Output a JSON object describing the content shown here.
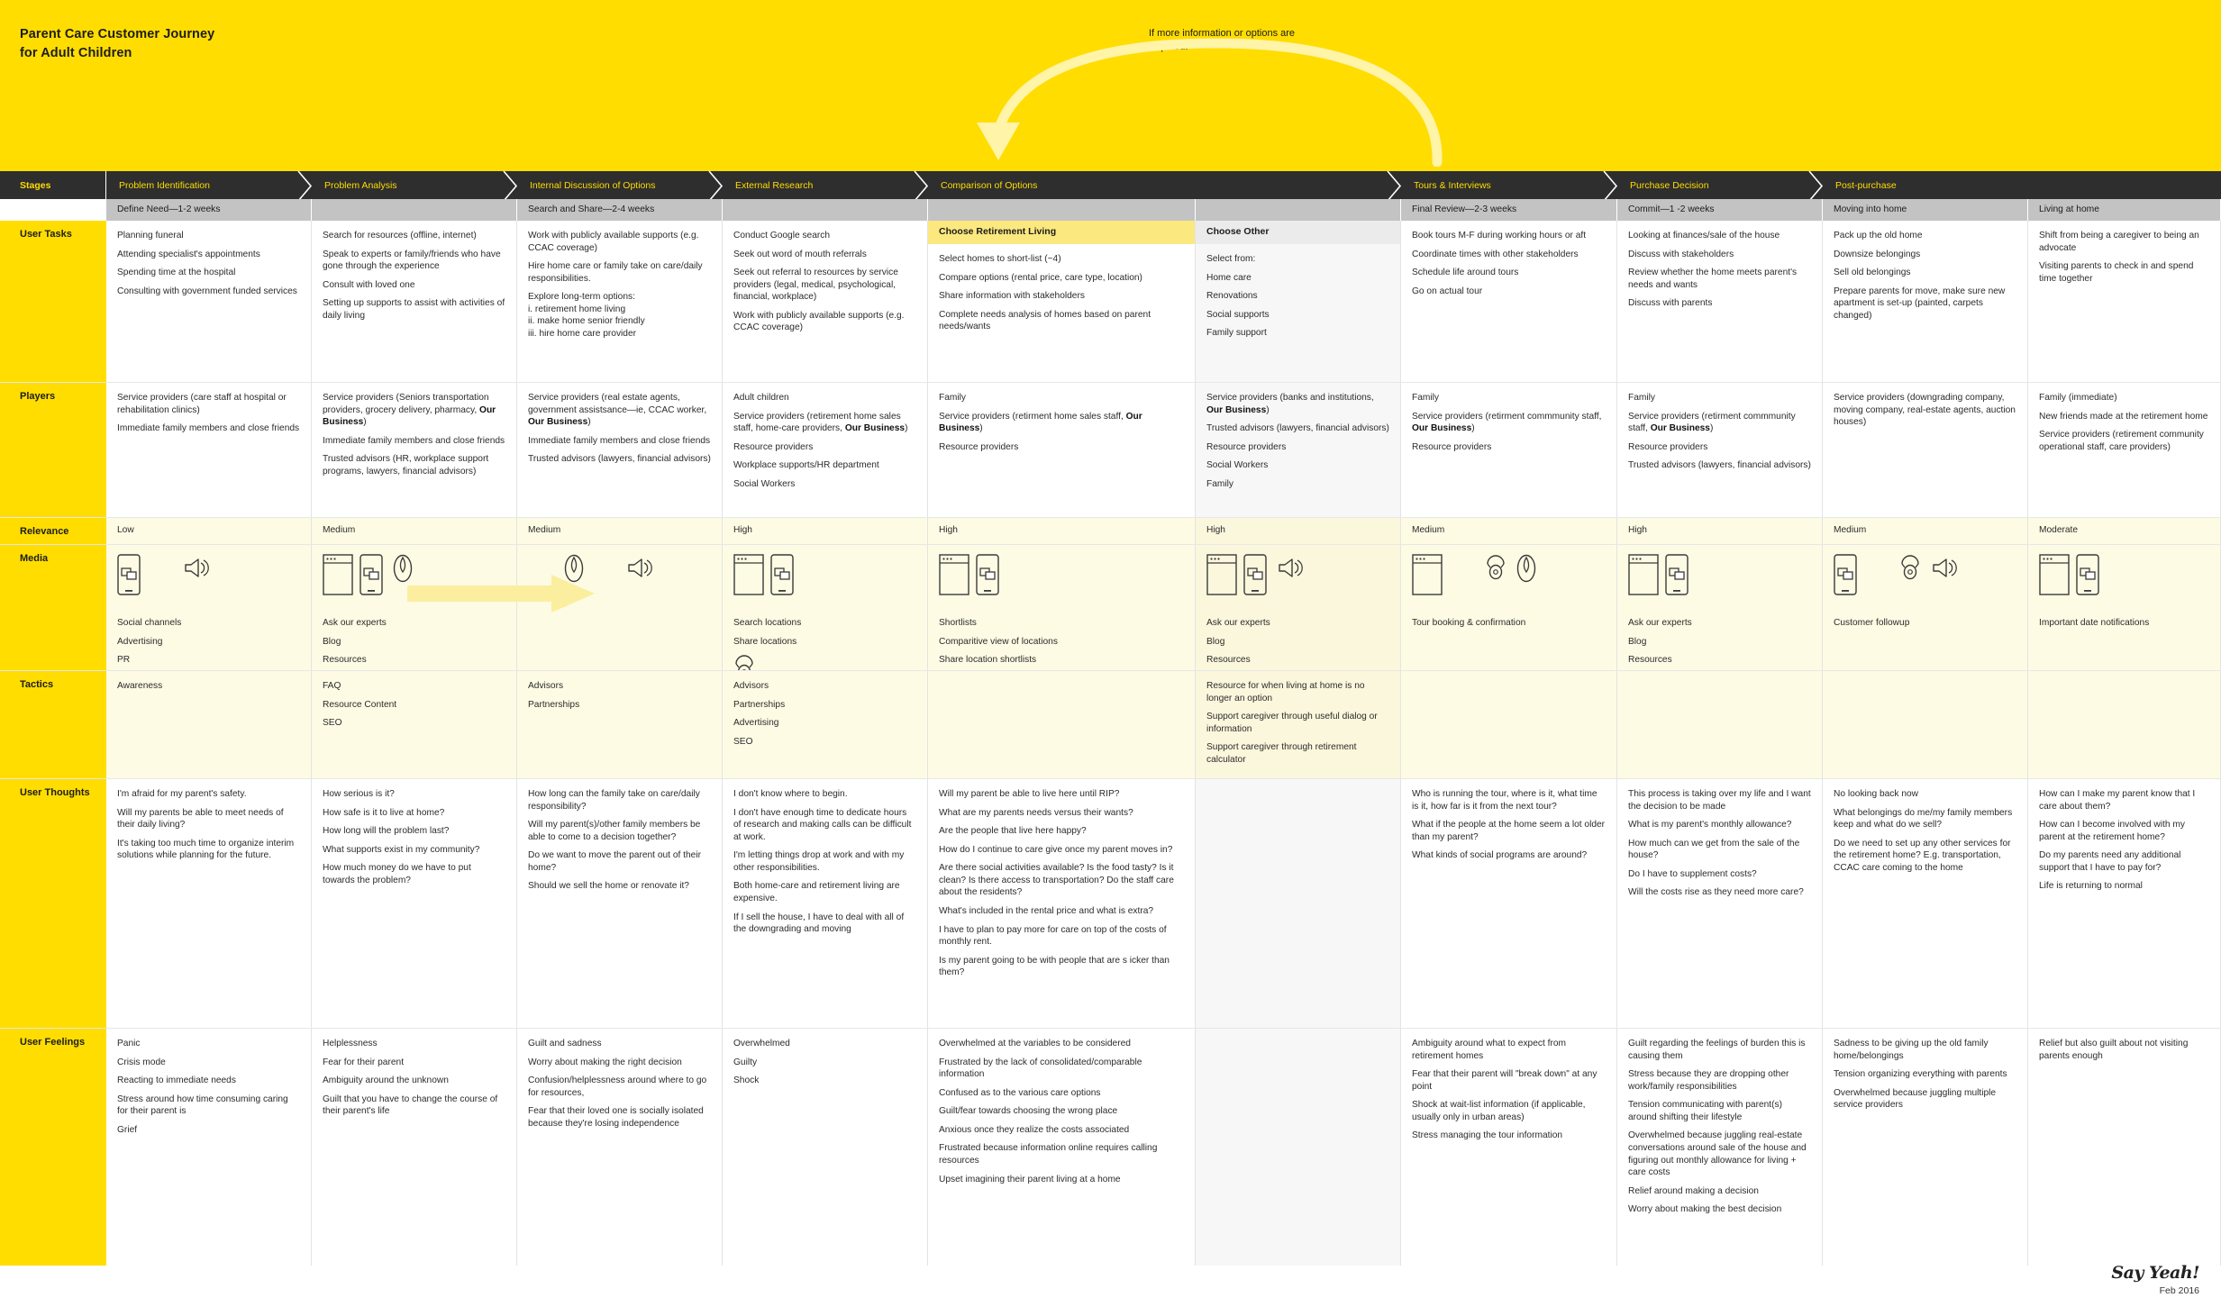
{
  "title": {
    "line1": "Parent Care Customer Journey",
    "line2": "for Adult Children"
  },
  "annotation": {
    "text": "If more information or options are required."
  },
  "colors": {
    "brand_yellow": "#FFDD00",
    "pale_yellow": "#FEFBE4",
    "dark_bar": "#2E2E2E",
    "grey_subheader": "#C3C3C3",
    "highlight_yellow": "#FBE87E"
  },
  "row_labels": {
    "stages": "Stages",
    "user_tasks": "User Tasks",
    "players": "Players",
    "relevance": "Relevance",
    "media": "Media",
    "tactics": "Tactics",
    "user_thoughts": "User Thoughts",
    "user_feelings": "User Feelings"
  },
  "stages": [
    "Problem Identification",
    "Problem Analysis",
    "Internal Discussion of Options",
    "External Research",
    "Comparison of Options",
    "Tours & Interviews",
    "Purchase Decision",
    "Post-purchase"
  ],
  "phase_headers": [
    "Define Need—1-2 weeks",
    "",
    "Search and Share—2-4 weeks",
    "",
    "",
    "",
    "Final Review—2-3 weeks",
    "Commit—1 -2 weeks",
    "Moving into home",
    "Living at home"
  ],
  "option_headers": {
    "retirement": "Choose Retirement Living",
    "other": "Choose Other"
  },
  "user_tasks": [
    [
      "Planning funeral",
      "Attending specialist's appointments",
      "Spending time at the hospital",
      "Consulting with government funded services"
    ],
    [
      "Search for resources (offline, internet)",
      "Speak to experts or family/friends who have gone through the experience",
      "Consult with loved one",
      "Setting up supports to assist with activities of daily living"
    ],
    [
      "Work with publicly available supports (e.g. CCAC coverage)",
      "Hire home care or family take on care/daily responsibilities.",
      "Explore long-term options:\ni. retirement home living\nii. make home senior friendly\niii. hire home care provider"
    ],
    [
      "Conduct Google search",
      "Seek out word of mouth referrals",
      "Seek out referral to resources by service providers (legal, medical, psychological, financial, workplace)",
      "Work with publicly available supports (e.g. CCAC coverage)"
    ],
    [
      "Select homes to short-list (~4)",
      "Compare options (rental price, care type, location)",
      "Share information with stakeholders",
      "Complete needs analysis of homes based on parent needs/wants"
    ],
    [
      "Select from:",
      "Home care",
      "Renovations",
      "Social supports",
      "Family support"
    ],
    [
      "Book tours M-F during working hours or aft",
      "Coordinate times with other stakeholders",
      "Schedule life around tours",
      "Go on actual tour"
    ],
    [
      "Looking at finances/sale of the house",
      "Discuss with stakeholders",
      "Review whether the home meets parent's needs and wants",
      "Discuss with parents"
    ],
    [
      "Pack up the old home",
      "Downsize belongings",
      "Sell old belongings",
      "Prepare parents for move, make sure new apartment is set-up (painted, carpets changed)"
    ],
    [
      "Shift from being a caregiver to being an advocate",
      "Visiting parents to check in and spend time together"
    ]
  ],
  "players": [
    [
      "Service providers (care staff at hospital or rehabilitation clinics)",
      "Immediate family members and close friends"
    ],
    [
      "Service providers (Seniors transportation providers, grocery delivery, pharmacy, <b>Our Business</b>)",
      "Immediate family members and close friends",
      "Trusted advisors (HR, workplace support programs, lawyers, financial advisors)"
    ],
    [
      "Service providers (real estate agents, government assistsance—ie, CCAC worker, <b>Our Business</b>)",
      "Immediate family members and close friends",
      "Trusted advisors (lawyers, financial advisors)"
    ],
    [
      "Adult children",
      "Service providers (retirement home sales staff, home-care providers, <b>Our Business</b>)",
      "Resource providers",
      "Workplace supports/HR department",
      "Social Workers"
    ],
    [
      "Family",
      "Service providers (retirment home sales staff, <b>Our Business</b>)",
      "Resource providers"
    ],
    [
      "Service providers (banks and institutions, <b>Our Business</b>)",
      "Trusted advisors (lawyers, financial advisors)",
      "Resource providers",
      "Social Workers",
      "Family"
    ],
    [
      "Family",
      "Service providers (retirment commmunity staff, <b>Our Business</b>)",
      "Resource providers"
    ],
    [
      "Family",
      "Service providers (retirment commmunity staff, <b>Our Business</b>)",
      "Resource providers",
      "Trusted advisors (lawyers, financial advisors)"
    ],
    [
      "Service providers (downgrading company, moving company, real-estate agents, auction houses)"
    ],
    [
      "Family (immediate)",
      "New friends made at the retirement home",
      "Service providers (retirement community operational staff, care providers)"
    ]
  ],
  "relevance": [
    "Low",
    "Medium",
    "Medium",
    "High",
    "High",
    "High",
    "Medium",
    "High",
    "Medium",
    "Moderate",
    "Low"
  ],
  "media": [
    {
      "icons": [
        "phone-chat-icon",
        "megaphone-icon"
      ],
      "labels": [
        "Social channels",
        "Advertising",
        "PR"
      ]
    },
    {
      "icons": [
        "browser-icon",
        "phone-chat-icon",
        "person-icon"
      ],
      "labels": [
        "Ask our experts",
        "Blog",
        "Resources"
      ]
    },
    {
      "icons": [
        "person-icon",
        "megaphone-icon"
      ],
      "labels": []
    },
    {
      "icons": [
        "browser-icon",
        "phone-chat-icon"
      ],
      "labels": [
        "Search locations",
        "Share locations"
      ],
      "extra_icon": "telephone-icon"
    },
    {
      "icons": [
        "browser-icon",
        "phone-chat-icon"
      ],
      "labels": [
        "Shortlists",
        "Comparitive view of locations",
        "Share location shortlists"
      ]
    },
    {
      "icons": [
        "browser-icon",
        "phone-chat-icon",
        "megaphone-icon"
      ],
      "labels": [
        "Ask our experts",
        "Blog",
        "Resources"
      ]
    },
    {
      "icons": [
        "browser-icon",
        "telephone-icon",
        "person-icon"
      ],
      "labels": [
        "Tour booking & confirmation"
      ]
    },
    {
      "icons": [
        "browser-icon",
        "phone-chat-icon"
      ],
      "labels": [
        "Ask our experts",
        "Blog",
        "Resources"
      ]
    },
    {
      "icons": [
        "phone-chat-icon",
        "telephone-icon",
        "megaphone-icon"
      ],
      "labels": [
        "Customer followup"
      ]
    },
    {
      "icons": [
        "browser-icon",
        "phone-chat-icon"
      ],
      "labels": [
        "Important date notifications"
      ]
    }
  ],
  "tactics": [
    [
      "Awareness"
    ],
    [
      "FAQ",
      "Resource Content",
      "SEO"
    ],
    [
      "Advisors",
      "Partnerships"
    ],
    [
      "Advisors",
      "Partnerships",
      "Advertising",
      "SEO"
    ],
    [],
    [
      "Resource for when living at home is no longer an option",
      "Support caregiver through useful dialog or information",
      "Support caregiver through retirement calculator"
    ],
    [],
    [],
    [],
    []
  ],
  "user_thoughts": [
    [
      "I'm afraid for my parent's safety.",
      "Will my parents be able to meet needs of their daily living?",
      "It's taking too much time to organize interim solutions while planning for the future."
    ],
    [
      "How serious is it?",
      "How safe is it to live at home?",
      "How long will the problem last?",
      "What supports exist in my community?",
      "How much money do we have to put towards the problem?"
    ],
    [
      "How long can the family take on care/daily responsibility?",
      "Will my parent(s)/other family members be able to come to a decision together?",
      "Do we want to move the parent out of their home?",
      "Should we sell the home or renovate it?"
    ],
    [
      "I don't know where to begin.",
      "I don't have enough time to dedicate hours of research and making calls can be difficult at work.",
      "I'm letting things drop at work and with my other responsibilities.",
      "Both home-care and retirement living are expensive.",
      "If I sell the house, I have to deal with all of the downgrading and moving"
    ],
    [
      "Will my parent be able to live here until RIP?",
      "What are my parents needs versus their wants?",
      "Are the people that live here happy?",
      "How do I continue to care give once my parent moves in?",
      "Are there social activities available? Is the food tasty? Is it clean? Is there access to transportation? Do the staff care about the residents?",
      "What's included in the rental price and what is extra?",
      "I have to plan to pay more for care on top of the costs of monthly rent.",
      "Is my parent going to be with people that are s icker than them?"
    ],
    [],
    [
      "Who is running the tour, where is it, what time is it, how far is it from the next tour?",
      "What if the people at the home seem a lot older than my parent?",
      "What kinds of social programs are around?"
    ],
    [
      "This process is taking over my life and I want the decision to be made",
      "What is my parent's monthly allowance?",
      "How much can we get from the sale of the house?",
      "Do I have to supplement costs?",
      "Will the costs rise as they need more care?"
    ],
    [
      "No looking back now",
      "What belongings do me/my family members keep and what do we sell?",
      "Do we need to set up any other services for the retirement home? E.g. transportation, CCAC care coming to the home"
    ],
    [
      "How can I make my parent know that I care about them?",
      "How can I become involved with my parent at the retirement home?",
      "Do my parents need any additional support that I have to pay for?",
      "Life is returning to normal"
    ]
  ],
  "user_feelings": [
    [
      "Panic",
      "Crisis mode",
      "Reacting to immediate needs",
      "Stress around how time consuming caring for their parent is",
      "Grief"
    ],
    [
      "Helplessness",
      "Fear for their parent",
      "Ambiguity around the unknown",
      "Guilt that you have to change the course of their parent's life"
    ],
    [
      "Guilt and sadness",
      "Worry about making the right decision",
      "Confusion/helplessness around where to go for resources,",
      "Fear that their loved one is socially isolated because they're losing independence"
    ],
    [
      "Overwhelmed",
      "Guilty",
      "Shock"
    ],
    [
      "Overwhelmed at the variables to be considered",
      "Frustrated by the lack of consolidated/comparable information",
      "Confused as to the various care options",
      "Guilt/fear towards choosing the wrong place",
      "Anxious once they realize the costs associated",
      "Frustrated because information online requires calling resources",
      "Upset imagining their parent living at a home"
    ],
    [],
    [
      "Ambiguity around what to expect from retirement homes",
      "Fear that their parent will \"break down\" at any point",
      "Shock at wait-list information (if applicable, usually only in urban areas)",
      "Stress managing the tour information"
    ],
    [
      "Guilt regarding the feelings of burden this is causing them",
      "Stress because they are dropping other work/family responsibilities",
      "Tension communicating with parent(s) around shifting their lifestyle",
      "Overwhelmed because juggling real-estate conversations around sale of the house and figuring out monthly allowance for living + care costs",
      "Relief around making a decision",
      "Worry about making the best decision"
    ],
    [
      "Sadness to be giving up the old family home/belongings",
      "Tension organizing everything with parents",
      "Overwhelmed because juggling multiple service providers"
    ],
    [
      "Relief but also guilt about not visiting parents enough"
    ]
  ],
  "footer": {
    "logo": "Say Yeah!",
    "date": "Feb 2016"
  }
}
